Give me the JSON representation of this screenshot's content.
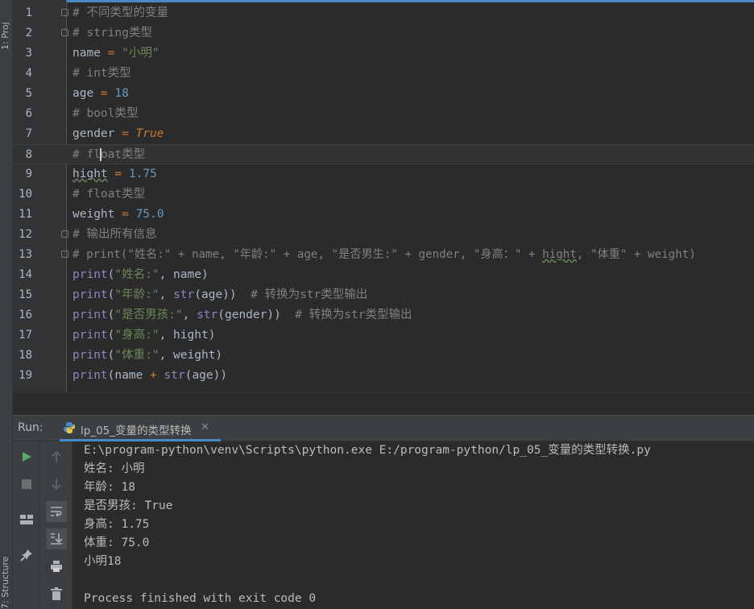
{
  "side_panels": {
    "project": "1: Proj",
    "structure": "7: Structure"
  },
  "editor": {
    "current_line": 8,
    "line_numbers": [
      "1",
      "2",
      "3",
      "4",
      "5",
      "6",
      "7",
      "8",
      "9",
      "10",
      "11",
      "12",
      "13",
      "14",
      "15",
      "16",
      "17",
      "18",
      "19"
    ]
  },
  "run": {
    "label": "Run:",
    "tab_name": "lp_05_变量的类型转换",
    "output": [
      "E:\\program-python\\venv\\Scripts\\python.exe E:/program-python/lp_05_变量的类型转换.py",
      "姓名: 小明",
      "年龄: 18",
      "是否男孩: True",
      "身高: 1.75",
      "体重: 75.0",
      "小明18",
      "",
      "Process finished with exit code 0"
    ]
  },
  "icons": [
    "run-icon",
    "stop-icon",
    "layout-icon",
    "pin-icon",
    "up-arrow-icon",
    "down-arrow-icon",
    "soft-wrap-icon",
    "scroll-end-icon",
    "print-icon",
    "trash-icon",
    "python-file-icon",
    "close-icon",
    "fold-icon"
  ],
  "colors": {
    "keyword": "#cc7832",
    "string": "#6a8759",
    "number": "#6897bb",
    "comment": "#808080",
    "builtin": "#8888c6",
    "text": "#a9b7c6",
    "background": "#2b2b2b"
  }
}
